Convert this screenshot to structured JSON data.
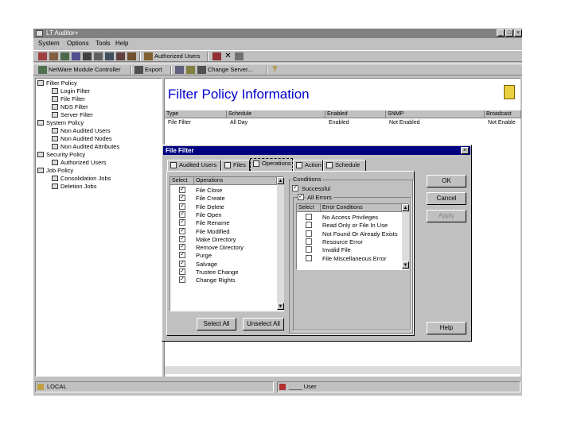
{
  "app": {
    "title": "LT Auditor+"
  },
  "menu": [
    "System",
    "Options",
    "Tools",
    "Help"
  ],
  "toolbar1": {
    "authorized_users": "Authorized Users"
  },
  "toolbar2": {
    "netware_module_controller": "NetWare Module Controller",
    "export": "Export",
    "change_server": "Change Server..."
  },
  "tree": [
    {
      "label": "Filter Policy",
      "level": 0
    },
    {
      "label": "Login Filter",
      "level": 1
    },
    {
      "label": "File Filter",
      "level": 1
    },
    {
      "label": "NDS Filter",
      "level": 1
    },
    {
      "label": "Server Filter",
      "level": 1
    },
    {
      "label": "System Policy",
      "level": 0
    },
    {
      "label": "Non Audited Users",
      "level": 1
    },
    {
      "label": "Non Audited Nodes",
      "level": 1
    },
    {
      "label": "Non Audited Attributes",
      "level": 1
    },
    {
      "label": "Security Policy",
      "level": 0
    },
    {
      "label": "Authorized Users",
      "level": 1
    },
    {
      "label": "Job Policy",
      "level": 0
    },
    {
      "label": "Consolidation Jobs",
      "level": 1
    },
    {
      "label": "Deletion Jobs",
      "level": 1
    }
  ],
  "main": {
    "title": "Filter Policy Information",
    "columns": [
      "Type",
      "Schedule",
      "Enabled",
      "SNMP",
      "Broadcast"
    ],
    "row": [
      "File Filter",
      "All Day",
      "Enabled",
      "Not Enabled",
      "Not Enable"
    ]
  },
  "status": {
    "left": "LOCAL",
    "right": "____ User"
  },
  "dialog": {
    "title": "File Filter",
    "tabs": [
      "Audited Users",
      "Files",
      "Operations",
      "Action",
      "Schedule"
    ],
    "ops_header": [
      "Select",
      "Operations"
    ],
    "operations": [
      {
        "label": "File Close",
        "checked": true
      },
      {
        "label": "File Create",
        "checked": true
      },
      {
        "label": "File Delete",
        "checked": true
      },
      {
        "label": "File Open",
        "checked": true
      },
      {
        "label": "File Rename",
        "checked": true
      },
      {
        "label": "File Modified",
        "checked": true
      },
      {
        "label": "Make Directory",
        "checked": true
      },
      {
        "label": "Remove Directory",
        "checked": true
      },
      {
        "label": "Purge",
        "checked": true
      },
      {
        "label": "Salvage",
        "checked": true
      },
      {
        "label": "Trustee Change",
        "checked": true
      },
      {
        "label": "Change Rights",
        "checked": true
      }
    ],
    "select_all": "Select All",
    "unselect_all": "Unselect All",
    "conditions_label": "Conditions",
    "successful": "Successful",
    "all_errors": "All Errors",
    "err_header": [
      "Select",
      "Error Conditions"
    ],
    "errors": [
      "No Access Privileges",
      "Read Only or File In Use",
      "Not Found Or Already Exists",
      "Resource Error",
      "Invalid File",
      "File Miscellaneous Error"
    ],
    "ok": "OK",
    "cancel": "Cancel",
    "apply": "Apply",
    "help": "Help"
  }
}
